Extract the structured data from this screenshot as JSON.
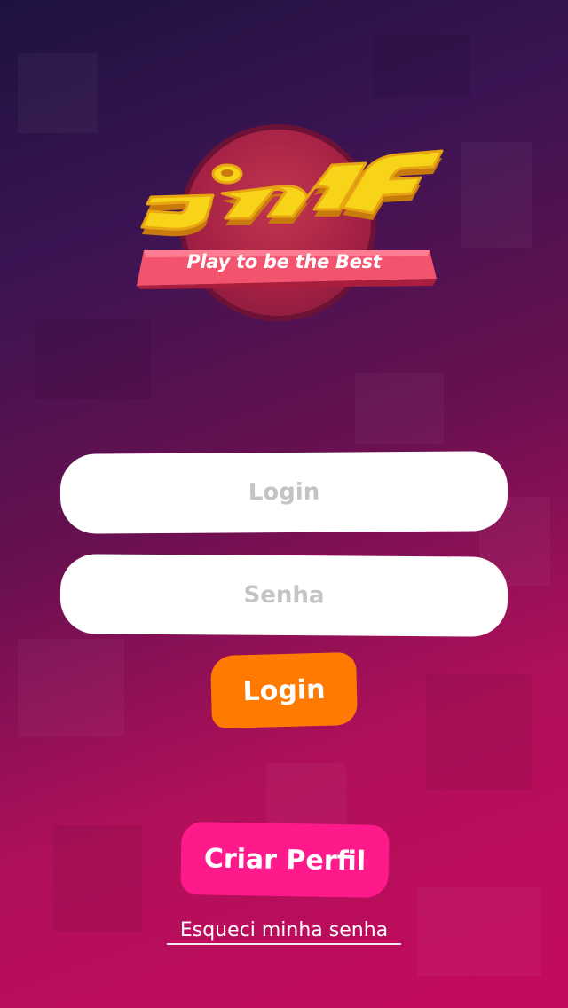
{
  "brand": {
    "name": "JMF",
    "tagline": "Play to be the Best",
    "colors": {
      "logo_yellow": "#f7d31a",
      "logo_orange": "#e89a10",
      "ribbon": "#f2536e",
      "circle": "#a32044"
    }
  },
  "form": {
    "login_placeholder": "Login",
    "password_placeholder": "Senha",
    "submit_label": "Login"
  },
  "actions": {
    "create_profile_label": "Criar Perfil",
    "forgot_password_label": "Esqueci minha senha"
  },
  "colors": {
    "login_button": "#ff7a00",
    "create_profile_button": "#ff1a8c",
    "input_background": "#ffffff",
    "placeholder": "#c4c4c4"
  }
}
